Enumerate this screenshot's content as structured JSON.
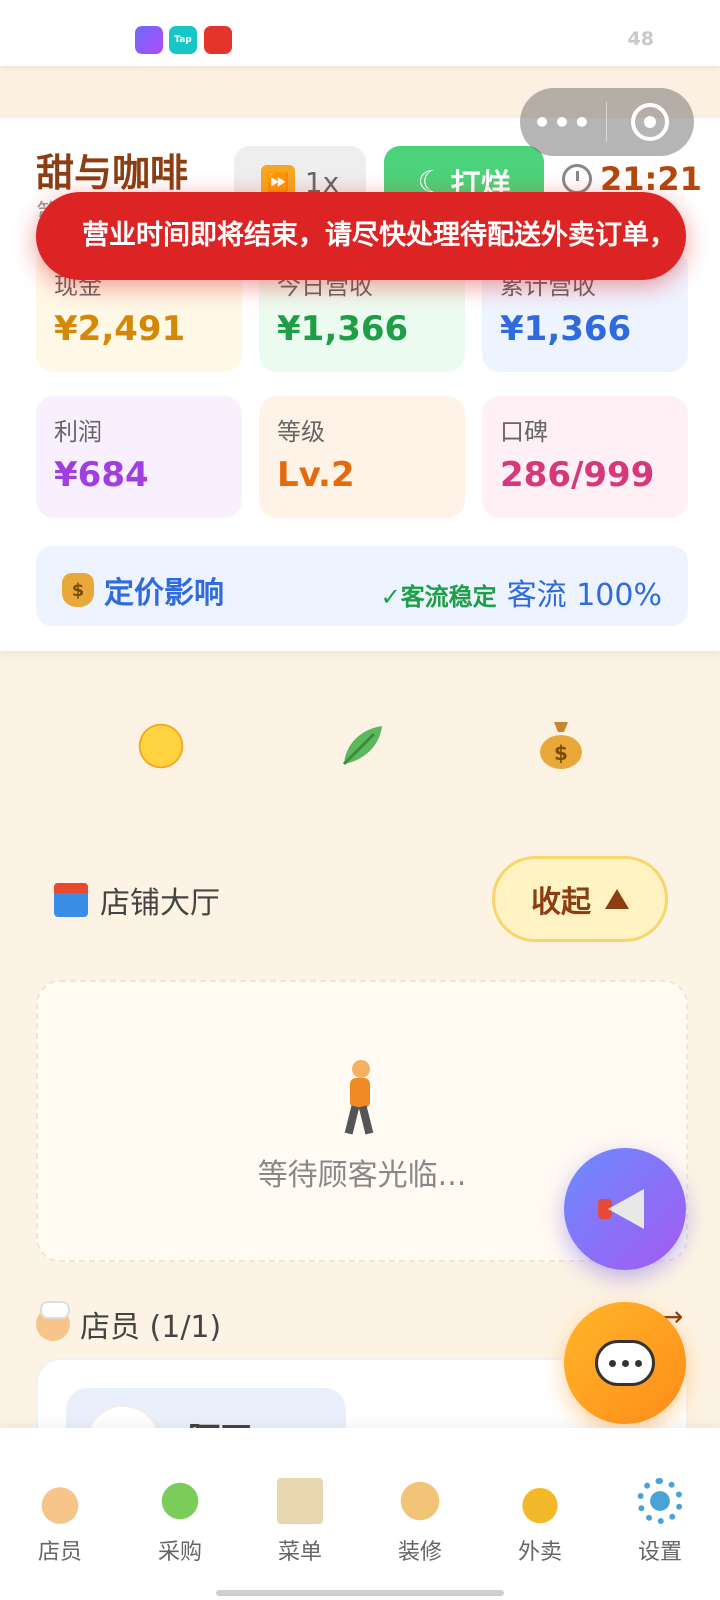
{
  "status_bar": {
    "apps": [
      "app-icon",
      "Tap",
      "app-icon"
    ],
    "battery": "48"
  },
  "header": {
    "shop_name": "甜与咖啡",
    "shop_sub": "第",
    "speed_label": "1x",
    "close_label": "打烊",
    "time": "21:21"
  },
  "toast": {
    "message": "营业时间即将结束，请尽快处理待配送外卖订单，"
  },
  "stats": [
    {
      "label": "现金",
      "value": "¥2,491"
    },
    {
      "label": "今日营收",
      "value": "¥1,366"
    },
    {
      "label": "累计营收",
      "value": "¥1,366"
    },
    {
      "label": "利润",
      "value": "¥684"
    },
    {
      "label": "等级",
      "value": "Lv.2"
    },
    {
      "label": "口碑",
      "value": "286/999"
    }
  ],
  "pricing": {
    "title": "定价影响",
    "status": "✓客流稳定",
    "flow": "客流 100%"
  },
  "weather_icons": [
    "sun-icon",
    "leaf-icon",
    "money-bag-icon"
  ],
  "hall": {
    "title": "店铺大厅",
    "collapse_label": "收起",
    "waiting_text": "等待顾客光临..."
  },
  "staff": {
    "title": "店员 (1/1)",
    "more_arrow": "→",
    "member_name": "阿正"
  },
  "bottom_nav": [
    {
      "label": "店员",
      "icon": "chef-icon"
    },
    {
      "label": "采购",
      "icon": "lettuce-icon"
    },
    {
      "label": "菜单",
      "icon": "book-icon"
    },
    {
      "label": "装修",
      "icon": "palette-icon"
    },
    {
      "label": "外卖",
      "icon": "scooter-icon"
    },
    {
      "label": "设置",
      "icon": "gear-icon"
    }
  ]
}
